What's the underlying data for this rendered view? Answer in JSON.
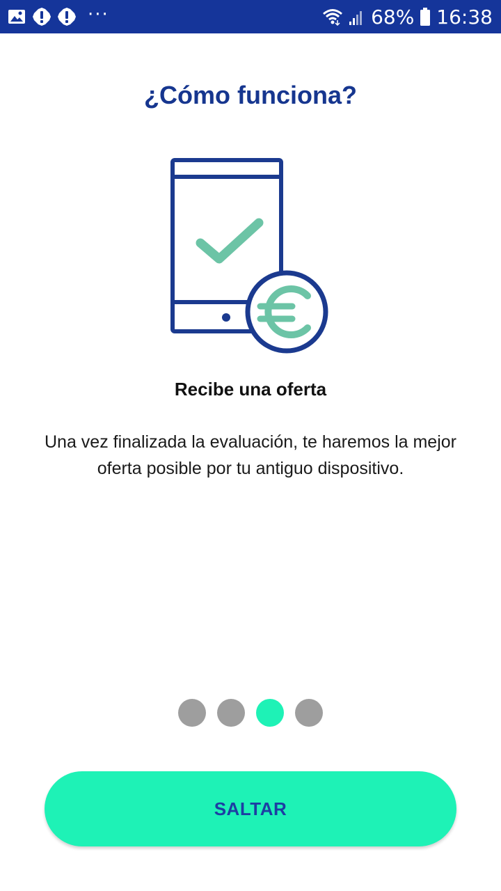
{
  "status_bar": {
    "left_icons": [
      "gallery-icon",
      "alert-icon",
      "alert-icon"
    ],
    "more": "···",
    "battery": "68%",
    "time": "16:38",
    "right_icons": [
      "wifi-icon",
      "signal-icon",
      "battery-icon"
    ]
  },
  "onboarding": {
    "title": "¿Cómo funciona?",
    "illustration_icon": "phone-check-euro-icon",
    "step_title": "Recibe una oferta",
    "description": "Una vez finalizada la evaluación, te haremos la mejor oferta posible por tu antiguo dispositivo.",
    "pager": {
      "total": 4,
      "active_index": 2
    },
    "skip_label": "SALTAR"
  },
  "colors": {
    "status_bar": "#15359a",
    "primary_blue": "#1b3a8f",
    "accent_green": "#6cc4a6",
    "button": "#1ef2b6",
    "dot_inactive": "#9e9e9e",
    "dot_active": "#1ef2b6"
  }
}
